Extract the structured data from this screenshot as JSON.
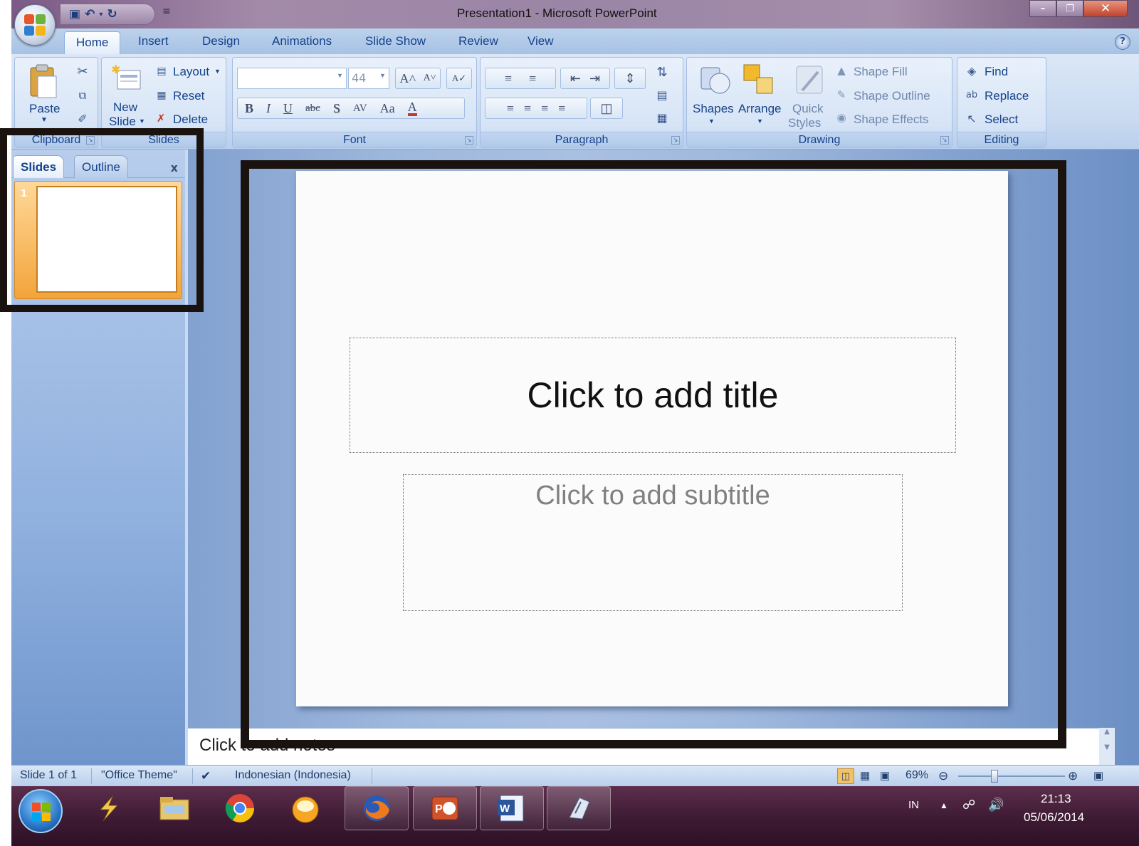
{
  "window": {
    "title": "Presentation1 - Microsoft PowerPoint",
    "controls": {
      "minimize": "–",
      "maximize": "❐",
      "close": "✕"
    }
  },
  "quick_access": {
    "save": "💾",
    "undo": "↶",
    "redo": "↻",
    "more": "≡"
  },
  "tabs": [
    {
      "label": "Home",
      "active": true
    },
    {
      "label": "Insert"
    },
    {
      "label": "Design"
    },
    {
      "label": "Animations"
    },
    {
      "label": "Slide Show"
    },
    {
      "label": "Review"
    },
    {
      "label": "View"
    }
  ],
  "ribbon": {
    "clipboard": {
      "group_label": "Clipboard",
      "paste": "Paste"
    },
    "slides": {
      "group_label": "Slides",
      "new_slide_1": "New",
      "new_slide_2": "Slide",
      "layout": "Layout",
      "reset": "Reset",
      "delete": "Delete"
    },
    "font": {
      "group_label": "Font",
      "font_name": "",
      "font_size": "44",
      "grow": "A˄",
      "shrink": "A˅",
      "clear": "A✓",
      "bold": "B",
      "italic": "I",
      "underline": "U",
      "strike": "abc",
      "shadow": "S",
      "spacing": "AV",
      "case": "Aa",
      "color": "A"
    },
    "paragraph": {
      "group_label": "Paragraph"
    },
    "drawing": {
      "group_label": "Drawing",
      "shapes": "Shapes",
      "arrange": "Arrange",
      "quick_styles_1": "Quick",
      "quick_styles_2": "Styles",
      "shape_fill": "Shape Fill",
      "shape_outline": "Shape Outline",
      "shape_effects": "Shape Effects"
    },
    "editing": {
      "group_label": "Editing",
      "find": "Find",
      "replace": "Replace",
      "select": "Select"
    }
  },
  "side_pane": {
    "tabs": [
      "Slides",
      "Outline"
    ],
    "close": "x",
    "thumbnails": [
      {
        "number": "1"
      }
    ]
  },
  "slide": {
    "title_placeholder": "Click to add title",
    "subtitle_placeholder": "Click to add subtitle"
  },
  "notes": {
    "placeholder": "Click to add notes"
  },
  "status_bar": {
    "slide_count": "Slide 1 of 1",
    "theme": "\"Office Theme\"",
    "language": "Indonesian (Indonesia)",
    "zoom": "69%",
    "zoom_percent": 69
  },
  "taskbar": {
    "apps": [
      "Winamp",
      "Windows Explorer",
      "Google Chrome",
      "Messenger",
      "Firefox",
      "PowerPoint",
      "Word",
      "App"
    ],
    "tray": {
      "language": "IN",
      "time": "21:13",
      "date": "05/06/2014"
    }
  },
  "colors": {
    "accent": "#15428b",
    "ribbon": "#d6e4f6",
    "thumb_selected": "#f3a43a",
    "highlight_box": "#1a120e"
  }
}
